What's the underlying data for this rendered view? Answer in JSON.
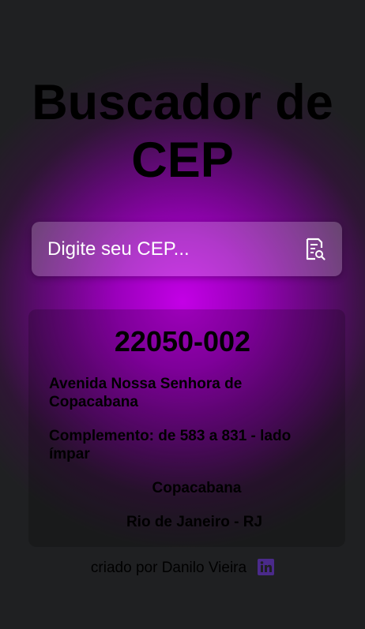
{
  "app": {
    "title_line1": "Buscador de",
    "title_line2": "CEP"
  },
  "search": {
    "placeholder": "Digite seu CEP...",
    "value": "",
    "button_icon": "search-document-icon"
  },
  "result": {
    "cep": "22050-002",
    "logradouro": "Avenida Nossa Senhora de Copacabana",
    "complemento": "Complemento: de 583 a 831 - lado ímpar",
    "bairro": "Copacabana",
    "cidade_uf": "Rio de Janeiro - RJ"
  },
  "footer": {
    "credit": "criado por Danilo Vieira",
    "social_icon": "linkedin-icon"
  },
  "colors": {
    "background": "#1f2022",
    "glow": "#c300e6",
    "text": "#000000",
    "input_text": "#ffffff",
    "linkedin": "#4a2a8a"
  }
}
